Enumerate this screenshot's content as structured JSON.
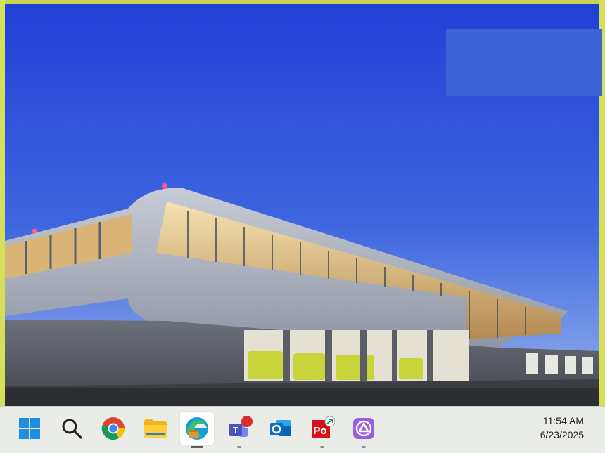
{
  "taskbar": {
    "apps": [
      {
        "name": "start-button",
        "icon": "windows-logo-icon"
      },
      {
        "name": "search-button",
        "icon": "search-icon"
      },
      {
        "name": "chrome-button",
        "icon": "chrome-icon"
      },
      {
        "name": "file-explorer-button",
        "icon": "folder-icon"
      },
      {
        "name": "edge-button",
        "icon": "edge-icon",
        "active": true
      },
      {
        "name": "teams-button",
        "icon": "teams-icon"
      },
      {
        "name": "outlook-button",
        "icon": "outlook-icon"
      },
      {
        "name": "acrobat-button",
        "icon": "acrobat-icon"
      },
      {
        "name": "app-button",
        "icon": "app-triangle-icon"
      }
    ],
    "clock": {
      "time": "11:54 AM",
      "date": "6/23/2025"
    }
  },
  "colors": {
    "sky_top": "#2342d8",
    "sky_bottom": "#6f8fe6",
    "taskbar_bg": "#e9ece7",
    "frame": "#d6df5a"
  }
}
